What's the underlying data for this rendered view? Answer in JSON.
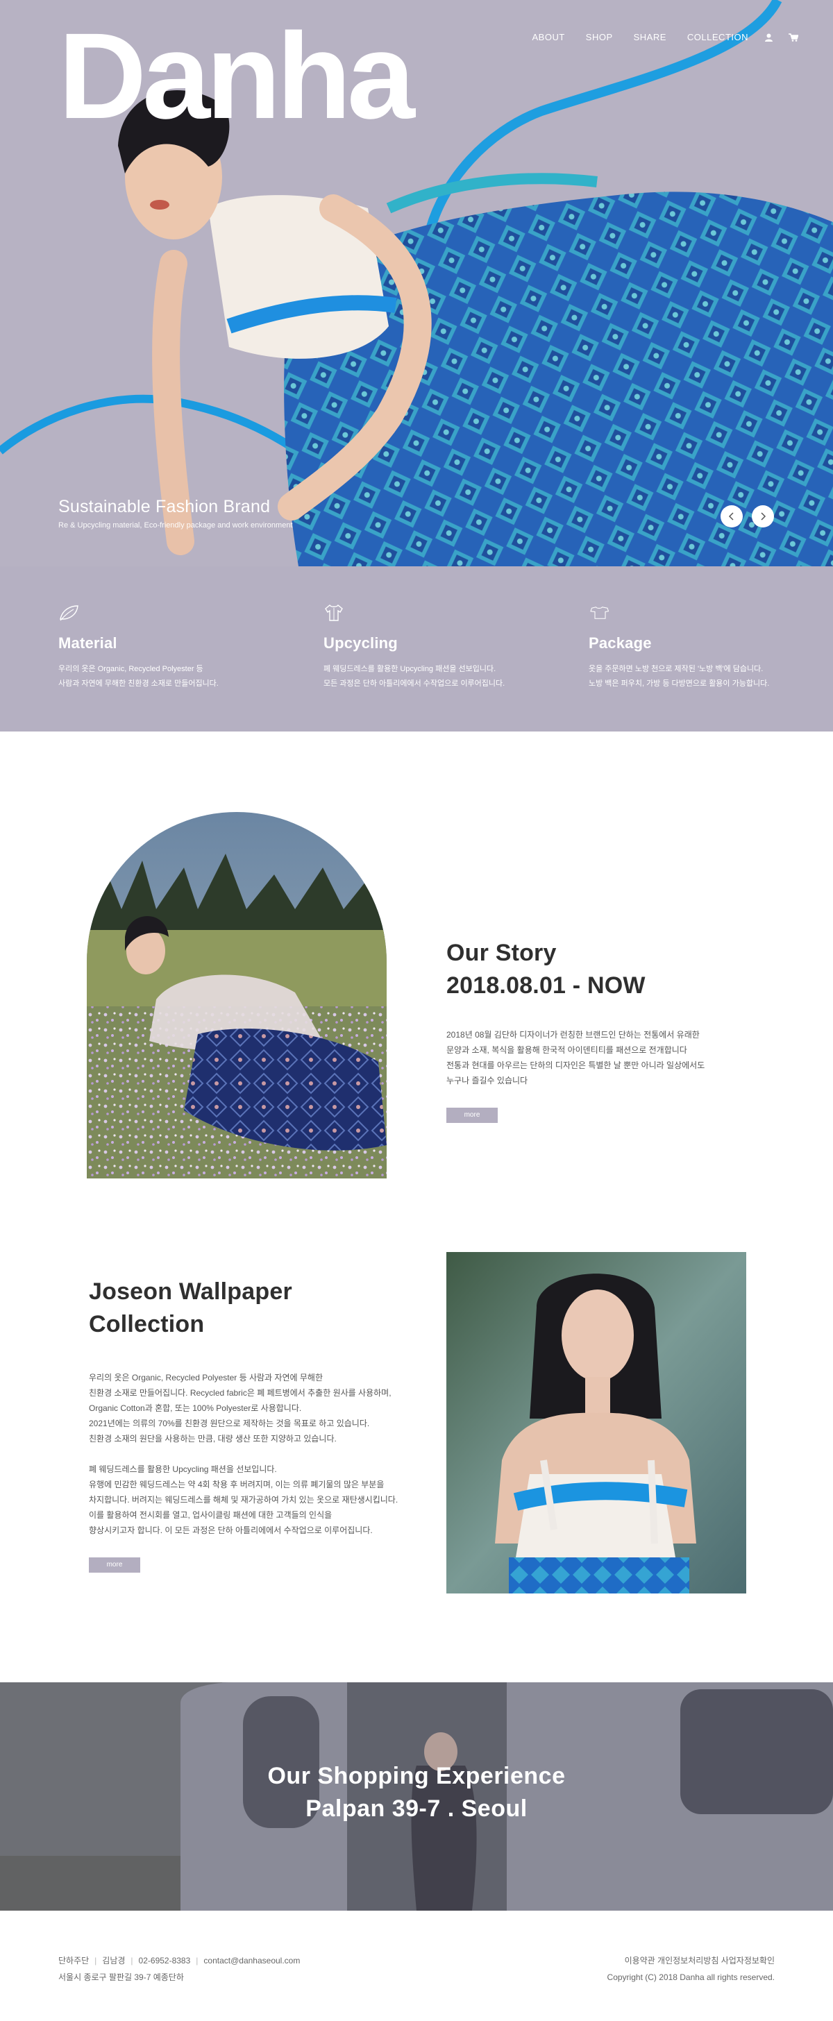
{
  "brand": {
    "name": "Danha"
  },
  "nav": {
    "items": [
      "ABOUT",
      "SHOP",
      "SHARE",
      "COLLECTION"
    ]
  },
  "hero": {
    "title": "Sustainable Fashion Brand",
    "subtitle": "Re & Upcycling material, Eco-friendly package and work environment"
  },
  "features": [
    {
      "icon": "leaf-icon",
      "title": "Material",
      "line1": "우리의 옷은 Organic, Recycled Polyester 등",
      "line2": "사람과 자연에 무해한 친환경 소재로 만들어집니다."
    },
    {
      "icon": "shirt-icon",
      "title": "Upcycling",
      "line1": "폐 웨딩드레스를 활용한 Upcycling 패션을 선보입니다.",
      "line2": "모든 과정은 단하 아틀리에에서 수작업으로 이루어집니다."
    },
    {
      "icon": "tshirt-outline-icon",
      "title": "Package",
      "line1": "옷을 주문하면 노방 천으로 제작된 '노방 백'에 담습니다.",
      "line2": "노방 백은 퍼우치, 가방 등 다방면으로 활용이 가능합니다."
    }
  ],
  "story": {
    "title_line1": "Our Story",
    "title_line2": "2018.08.01 - NOW",
    "lines": [
      "2018년 08월 김단하 디자이너가 런칭한 브랜드인 단하는 전통에서 유래한",
      "문양과 소재, 복식을 활용해 한국적 아이덴티티를 패션으로 전개합니다",
      "전통과 현대를 아우르는 단하의 디자인은 특별한 날 뿐만 아니라 일상에서도",
      "누구나 즐길수 있습니다"
    ],
    "more_label": "more"
  },
  "collection": {
    "title_line1": "Joseon Wallpaper",
    "title_line2": "Collection",
    "para1": [
      "우리의 옷은 Organic, Recycled Polyester 등 사람과 자연에 무해한",
      "친환경 소재로 만들어집니다. Recycled fabric은 폐 페트병에서 추출한 원사를 사용하며,",
      "Organic Cotton과 혼합, 또는 100% Polyester로 사용합니다.",
      "2021년에는 의류의 70%를 친환경 원단으로 제작하는 것을 목표로 하고 있습니다.",
      "친환경 소재의 원단을 사용하는 만큼, 대량 생산 또한 지양하고 있습니다."
    ],
    "para2": [
      "폐 웨딩드레스를 활용한 Upcycling 패션을 선보입니다.",
      "유행에 민감한 웨딩드레스는 약 4회 착용 후 버려지며, 이는 의류 폐기물의 많은 부분을",
      "차지합니다. 버려지는 웨딩드레스를 해체 및 재가공하여 가치 있는 옷으로 재탄생시킵니다.",
      "이를 활용하여 전시회를 열고, 업사이클링 패션에 대한 고객들의 인식을",
      "향상시키고자 합니다. 이 모든 과정은 단하 아틀리에에서 수작업으로 이루어집니다."
    ],
    "more_label": "more"
  },
  "shopping": {
    "line1": "Our Shopping Experience",
    "line2": "Palpan 39-7 . Seoul"
  },
  "footer": {
    "company": "단하주단",
    "ceo": "김남경",
    "phone": "02-6952-8383",
    "email": "contact@danhaseoul.com",
    "address": "서울시 종로구 팔판길 39-7 예종단하",
    "links": "이용약관  개인정보처리방침  사업자정보확인",
    "copyright": "Copyright (C) 2018 Danha all rights reserved."
  },
  "colors": {
    "lavender": "#b7b2c3",
    "button": "#b3aec0",
    "ribbon_blue": "#1e9ee0"
  }
}
